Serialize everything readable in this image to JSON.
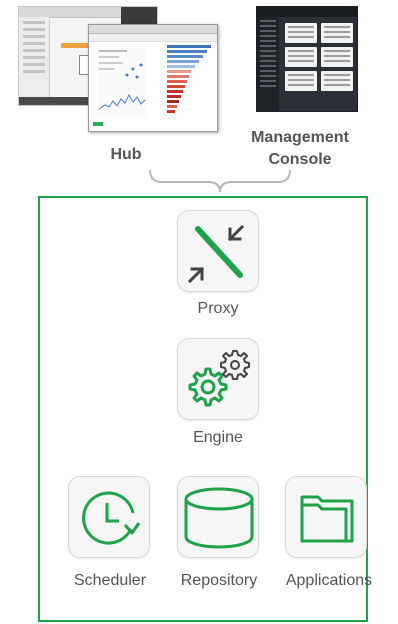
{
  "hub": {
    "label": "Hub"
  },
  "management_console": {
    "label_line1": "Management",
    "label_line2": "Console"
  },
  "components": {
    "proxy": {
      "label": "Proxy",
      "icon": "proxy-icon"
    },
    "engine": {
      "label": "Engine",
      "icon": "gears-icon"
    },
    "scheduler": {
      "label": "Scheduler",
      "icon": "clock-refresh-icon"
    },
    "repository": {
      "label": "Repository",
      "icon": "database-icon"
    },
    "applications": {
      "label": "Applications",
      "icon": "folder-icon"
    }
  },
  "colors": {
    "accent_green": "#1ea34a",
    "label_gray": "#555555",
    "tile_bg": "#f6f6f6"
  }
}
